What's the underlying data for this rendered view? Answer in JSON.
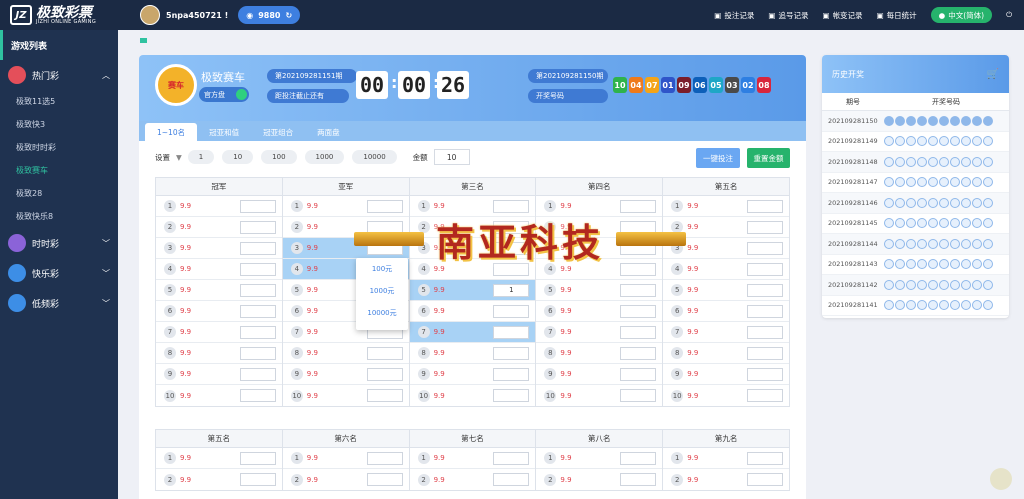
{
  "brand": {
    "name": "极致彩票",
    "tagline": "JIZHI ONLINE GAMING",
    "mark": "JZ"
  },
  "user": {
    "name": "5npa450721 !",
    "balance": "9880"
  },
  "toplinks": [
    {
      "label": "投注记录",
      "icon": "clipboard-icon"
    },
    {
      "label": "追号记录",
      "icon": "document-icon"
    },
    {
      "label": "帐变记录",
      "icon": "refresh-icon"
    },
    {
      "label": "每日统计",
      "icon": "pie-chart-icon"
    }
  ],
  "language": "中文(简体)",
  "sidebar": {
    "title": "游戏列表",
    "categories": [
      {
        "label": "热门彩",
        "color": "#e44f5a",
        "expanded": true,
        "items": [
          "极致11选5",
          "极致快3",
          "极致时时彩",
          "极致赛车",
          "极致28",
          "极致快乐8"
        ]
      },
      {
        "label": "时时彩",
        "color": "#8b63d8"
      },
      {
        "label": "快乐彩",
        "color": "#3d8ee6"
      },
      {
        "label": "低频彩",
        "color": "#3d8ee6"
      }
    ],
    "active_item": "极致赛车"
  },
  "game": {
    "badge": "赛车",
    "name": "极致赛车",
    "mode": "官方盘",
    "current_period": "第202109281151期",
    "countdown_label": "距投注截止还有",
    "timer": [
      "00",
      "00",
      "26"
    ],
    "last_period": "第202109281150期",
    "draw_label": "开奖号码",
    "draw_numbers": [
      "10",
      "04",
      "07",
      "01",
      "09",
      "06",
      "05",
      "03",
      "02",
      "08"
    ],
    "ball_colors": [
      "#2fb34b",
      "#ef7a1b",
      "#f4a417",
      "#2f55c9",
      "#7b1e2a",
      "#0d5fb9",
      "#1fa7c6",
      "#4a4a4a",
      "#2e7fe2",
      "#d8263d"
    ]
  },
  "tabs": [
    "1~10名",
    "冠亚和值",
    "冠亚组合",
    "两面盘"
  ],
  "controls": {
    "settings_label": "设置",
    "chips": [
      "1",
      "10",
      "100",
      "1000",
      "10000"
    ],
    "amount_label": "金额",
    "amount": "10",
    "quick_bet": "一键投注",
    "reset": "重置金额"
  },
  "grid1": {
    "headers": [
      "冠军",
      "亚军",
      "第三名",
      "第四名",
      "第五名"
    ],
    "rows": [
      "1",
      "2",
      "3",
      "4",
      "5",
      "6",
      "7",
      "8",
      "9",
      "10"
    ],
    "odds": "9.9",
    "filled_value": "1"
  },
  "grid2": {
    "headers": [
      "第五名",
      "第六名",
      "第七名",
      "第八名",
      "第九名"
    ]
  },
  "dropdown": [
    "100元",
    "1000元",
    "10000元"
  ],
  "watermark": "南亚科技",
  "history": {
    "title": "历史开奖",
    "col_period": "期号",
    "col_numbers": "开奖号码",
    "periods": [
      "202109281150",
      "202109281149",
      "202109281148",
      "202109281147",
      "202109281146",
      "202109281145",
      "202109281144",
      "202109281143",
      "202109281142",
      "202109281141"
    ]
  }
}
